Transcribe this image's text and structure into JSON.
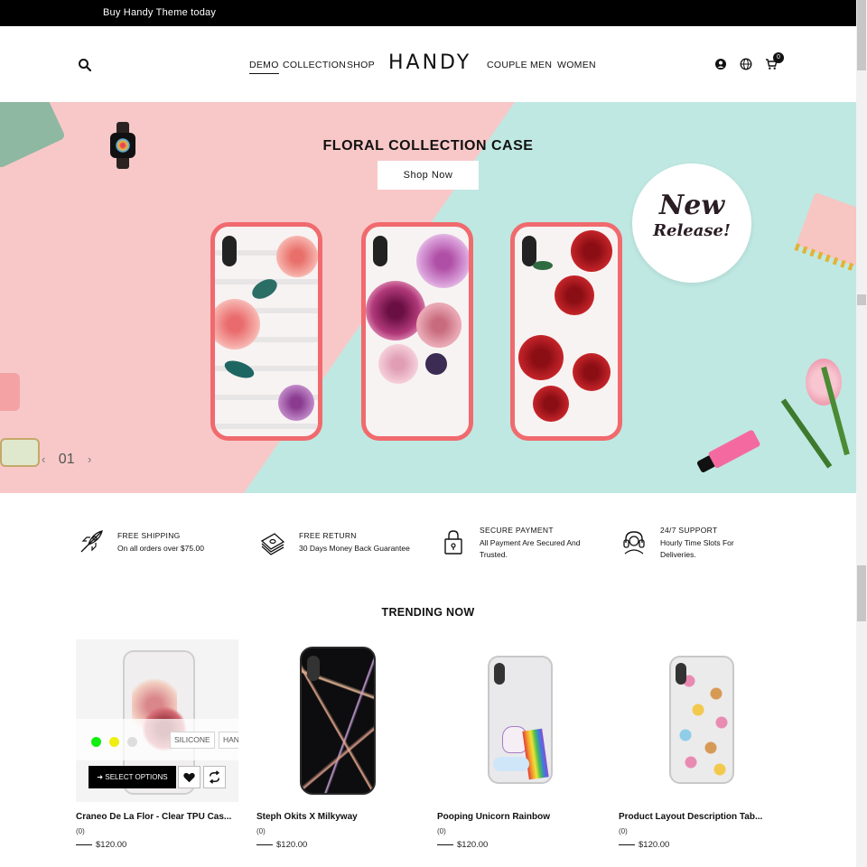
{
  "topbar": {
    "text": "Buy Handy Theme today"
  },
  "header": {
    "logo": "HANDY",
    "nav_left": [
      "DEMO",
      "COLLECTION",
      "SHOP"
    ],
    "nav_right": [
      "COUPLE",
      "MEN",
      "WOMEN"
    ],
    "cart_count": "0"
  },
  "hero": {
    "title": "FLORAL COLLECTION CASE",
    "button": "Shop Now",
    "badge_line1": "New",
    "badge_line2": "Release!",
    "slide_number": "01",
    "colors": {
      "pink": "#f8c8c8",
      "mint": "#bfe8e2",
      "bumper": "#f06a6e"
    }
  },
  "features": [
    {
      "icon": "rocket-icon",
      "title": "FREE SHIPPING",
      "desc": "On all orders over $75.00"
    },
    {
      "icon": "money-icon",
      "title": "FREE RETURN",
      "desc": "30 Days Money Back Guarantee"
    },
    {
      "icon": "lock-icon",
      "title": "SECURE PAYMENT",
      "desc": "All Payment Are Secured And Trusted."
    },
    {
      "icon": "headset-icon",
      "title": "24/7 SUPPORT",
      "desc": "Hourly Time Slots For Deliveries."
    }
  ],
  "trending": {
    "title": "TRENDING NOW",
    "products": [
      {
        "name": "Craneo De La Flor - Clear TPU Cas...",
        "rating": "(0)",
        "price": "$120.00"
      },
      {
        "name": "Steph Okits X Milkyway",
        "rating": "(0)",
        "price": "$120.00"
      },
      {
        "name": "Pooping Unicorn Rainbow",
        "rating": "(0)",
        "price": "$120.00"
      },
      {
        "name": "Product Layout Description Tab...",
        "rating": "(0)",
        "price": "$120.00"
      }
    ],
    "hover": {
      "swatch_colors": [
        "#11ee11",
        "#eeee11",
        "#dddddd"
      ],
      "options": [
        "SILICONE",
        "HAN"
      ],
      "select_label": "SELECT OPTIONS"
    }
  }
}
